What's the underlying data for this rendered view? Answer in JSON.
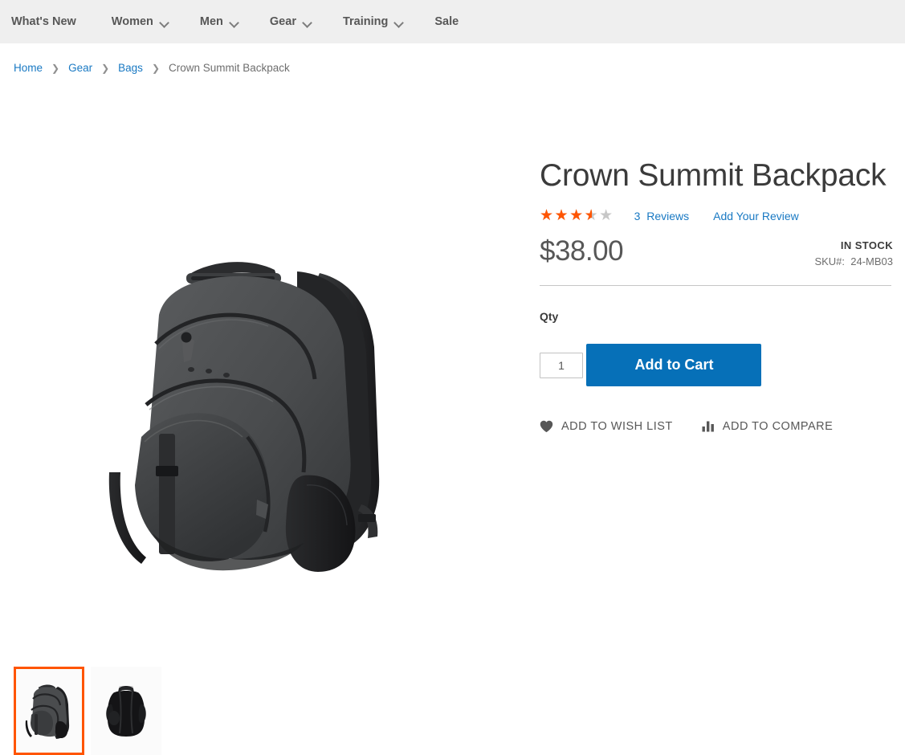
{
  "nav": {
    "items": [
      {
        "label": "What's New",
        "has_dropdown": false
      },
      {
        "label": "Women",
        "has_dropdown": true
      },
      {
        "label": "Men",
        "has_dropdown": true
      },
      {
        "label": "Gear",
        "has_dropdown": true
      },
      {
        "label": "Training",
        "has_dropdown": true
      },
      {
        "label": "Sale",
        "has_dropdown": false
      }
    ]
  },
  "breadcrumbs": {
    "items": [
      {
        "label": "Home",
        "current": false
      },
      {
        "label": "Gear",
        "current": false
      },
      {
        "label": "Bags",
        "current": false
      },
      {
        "label": "Crown Summit Backpack",
        "current": true
      }
    ],
    "separator": "❯"
  },
  "gallery": {
    "main_image_alt": "Crown Summit Backpack front three-quarter view",
    "thumbnails": [
      {
        "alt": "Crown Summit Backpack front view",
        "selected": true
      },
      {
        "alt": "Crown Summit Backpack back view",
        "selected": false
      }
    ]
  },
  "product": {
    "title": "Crown Summit Backpack",
    "rating": {
      "value": 3.5,
      "max": 5,
      "percent": "70%",
      "stars_glyphs": "★★★★★",
      "reviews_count": "3",
      "reviews_label": "Reviews",
      "add_review_label": "Add Your Review"
    },
    "price": "$38.00",
    "stock_status": "IN STOCK",
    "sku_label": "SKU#:",
    "sku_value": "24-MB03",
    "qty_label": "Qty",
    "qty_value": "1",
    "add_to_cart_label": "Add to Cart",
    "wishlist_label": "ADD TO WISH LIST",
    "compare_label": "ADD TO COMPARE"
  },
  "colors": {
    "nav_background": "#efefef",
    "link_blue": "#1979c3",
    "button_blue": "#0670b8",
    "accent_orange": "#ff5501",
    "star_empty": "#c7c7c7",
    "text_dark": "#3b3b3b",
    "text_muted": "#6e6e6e"
  }
}
